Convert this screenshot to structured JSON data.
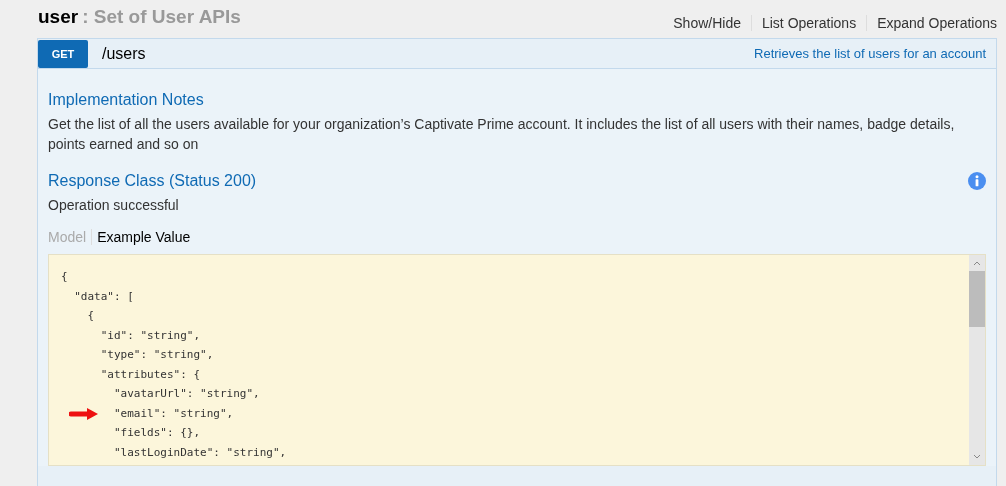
{
  "resource": {
    "name": "user",
    "description": ": Set of User APIs"
  },
  "header_links": [
    "Show/Hide",
    "List Operations",
    "Expand Operations"
  ],
  "operation": {
    "method": "GET",
    "path": "/users",
    "summary": "Retrieves the list of users for an account"
  },
  "implementation_notes": {
    "title": "Implementation Notes",
    "text": "Get the list of all the users available for your organization’s Captivate Prime account. It includes the list of all users with their names, badge details, points earned and so on"
  },
  "response_class": {
    "title": "Response Class (Status 200)",
    "text": "Operation successful"
  },
  "tabs": [
    {
      "label": "Model",
      "selected": false
    },
    {
      "label": "Example Value",
      "selected": true
    }
  ],
  "code_lines": [
    {
      "text": "{",
      "arrow": false
    },
    {
      "text": "  \"data\": [",
      "arrow": false
    },
    {
      "text": "    {",
      "arrow": false
    },
    {
      "text": "      \"id\": \"string\",",
      "arrow": false
    },
    {
      "text": "      \"type\": \"string\",",
      "arrow": false
    },
    {
      "text": "      \"attributes\": {",
      "arrow": false
    },
    {
      "text": "        \"avatarUrl\": \"string\",",
      "arrow": false
    },
    {
      "text": "        \"email\": \"string\",",
      "arrow": true
    },
    {
      "text": "        \"fields\": {},",
      "arrow": false
    },
    {
      "text": "        \"lastLoginDate\": \"string\",",
      "arrow": false
    }
  ]
}
